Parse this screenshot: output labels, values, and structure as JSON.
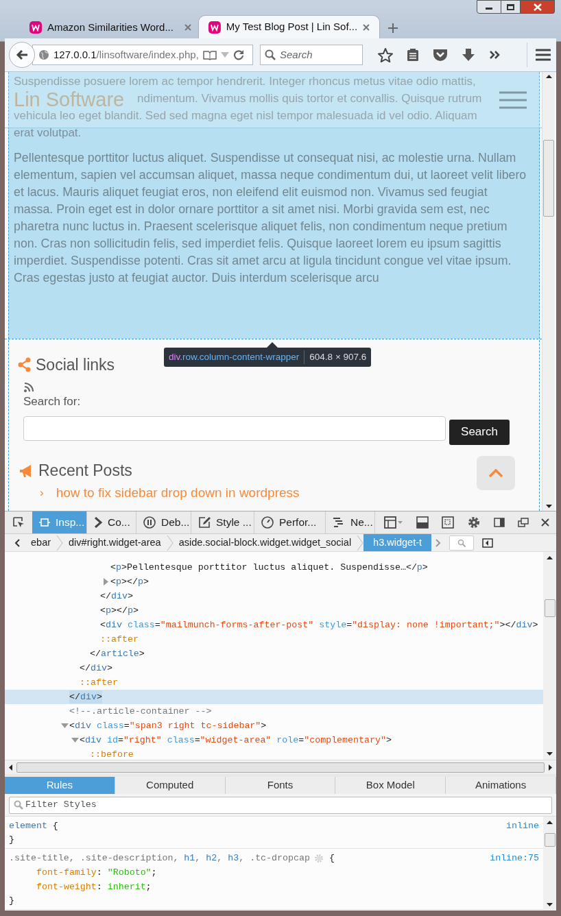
{
  "browser": {
    "tabs": [
      {
        "title": "Amazon Similarities Word...",
        "selected": false
      },
      {
        "title": "My Test Blog Post | Lin Sof...",
        "selected": true
      }
    ],
    "url": {
      "host": "127.0.0.1",
      "path": "/linsoftware/index.php,"
    },
    "search": {
      "placeholder": "Search"
    }
  },
  "page": {
    "site_title": "Lin Software",
    "intro_lines": [
      "Suspendisse posuere lorem ac tempor hendrerit. Integer rhoncus metus vitae odio mattis,",
      "ndimentum. Vivamus mollis quis tortor et convallis. Quisque rutrum",
      "vehicula leo eget blandit. Sed sed magna eget nisl tempor malesuada id vel odio. Aliquam",
      "erat volutpat."
    ],
    "paragraph": "Pellentesque porttitor luctus aliquet. Suspendisse ut consequat nisi, ac molestie urna. Nullam elementum, sapien vel accumsan aliquet, massa neque condimentum dui, ut laoreet velit libero et lacus. Mauris aliquet feugiat eros, non eleifend elit euismod non. Vivamus sed feugiat massa. Proin eget est in dolor ornare porttitor a sit amet nisi. Morbi gravida sem est, nec pharetra nunc luctus in. Praesent scelerisque aliquet felis, non condimentum neque pretium non. Cras non sollicitudin felis, sed imperdiet felis. Quisque laoreet lorem eu ipsum sagittis imperdiet. Suspendisse potenti. Cras sit amet arcu at ligula tincidunt congue vel vitae ipsum. Cras egestas justo at feugiat auctor. Duis interdum scelerisque arcu",
    "tooltip": {
      "tag": "div",
      "classes": ".row.column-content-wrapper",
      "size": "604.8 × 907.6"
    },
    "social_heading": "Social links",
    "search_label": "Search for:",
    "search_button": "Search",
    "recent_heading": "Recent Posts",
    "recent_posts": [
      {
        "marker": "›",
        "title": "how to fix sidebar drop down in wordpress"
      }
    ]
  },
  "devtools": {
    "tools": [
      {
        "label": "Insp...",
        "selected": true
      },
      {
        "label": "Co...",
        "selected": false
      },
      {
        "label": "Deb...",
        "selected": false
      },
      {
        "label": "Style ...",
        "selected": false
      },
      {
        "label": "Perfor...",
        "selected": false
      },
      {
        "label": "Ne...",
        "selected": false
      }
    ],
    "breadcrumbs": [
      {
        "label": "ebar",
        "selected": false
      },
      {
        "label": "div#right.widget-area",
        "selected": false
      },
      {
        "label": "aside.social-block.widget.widget_social",
        "selected": false
      },
      {
        "label": "h3.widget-t",
        "selected": true
      }
    ],
    "markup": [
      {
        "children": [
          {
            "children": [
              {
                "children": [
                  {
                    "children": [
                      {
                        "selected": false,
                        "tokens": [
                          {
                            "kind": "punct",
                            "text": "<"
                          },
                          {
                            "kind": "name",
                            "text": "p"
                          },
                          {
                            "kind": "punct",
                            "text": ">Pellentesque porttitor luctus aliquet. Suspendisse…</"
                          },
                          {
                            "kind": "name",
                            "text": "p"
                          },
                          {
                            "kind": "punct",
                            "text": ">"
                          }
                        ]
                      },
                      {
                        "selected": false,
                        "expanded": false,
                        "tokens": [
                          {
                            "kind": "punct",
                            "text": "<"
                          },
                          {
                            "kind": "name",
                            "text": "p"
                          },
                          {
                            "kind": "punct",
                            "text": "></"
                          },
                          {
                            "kind": "name",
                            "text": "p"
                          },
                          {
                            "kind": "punct",
                            "text": ">"
                          }
                        ]
                      }
                    ]
                  },
                  {
                    "selected": false,
                    "tokens": [
                      {
                        "kind": "punct",
                        "text": "</"
                      },
                      {
                        "kind": "name",
                        "text": "div"
                      },
                      {
                        "kind": "punct",
                        "text": ">"
                      }
                    ]
                  },
                  {
                    "selected": false,
                    "tokens": [
                      {
                        "kind": "punct",
                        "text": "<"
                      },
                      {
                        "kind": "name",
                        "text": "p"
                      },
                      {
                        "kind": "punct",
                        "text": "></"
                      },
                      {
                        "kind": "name",
                        "text": "p"
                      },
                      {
                        "kind": "punct",
                        "text": ">"
                      }
                    ]
                  },
                  {
                    "selected": false,
                    "tokens": [
                      {
                        "kind": "punct",
                        "text": "<"
                      },
                      {
                        "kind": "name",
                        "text": "div"
                      },
                      {
                        "kind": "attr",
                        "text": " class"
                      },
                      {
                        "kind": "punct",
                        "text": "="
                      },
                      {
                        "kind": "value",
                        "text": "\"mailmunch-forms-after-post\""
                      },
                      {
                        "kind": "attr",
                        "text": " style"
                      },
                      {
                        "kind": "punct",
                        "text": "="
                      },
                      {
                        "kind": "value",
                        "text": "\"display: none !important;\""
                      },
                      {
                        "kind": "punct",
                        "text": "></"
                      },
                      {
                        "kind": "name",
                        "text": "div"
                      },
                      {
                        "kind": "punct",
                        "text": ">"
                      }
                    ]
                  },
                  {
                    "selected": false,
                    "tokens": [
                      {
                        "kind": "pseudo",
                        "text": "::after"
                      }
                    ]
                  }
                ]
              },
              {
                "selected": false,
                "tokens": [
                  {
                    "kind": "punct",
                    "text": "</"
                  },
                  {
                    "kind": "name",
                    "text": "article"
                  },
                  {
                    "kind": "punct",
                    "text": ">"
                  }
                ]
              }
            ]
          },
          {
            "selected": false,
            "tokens": [
              {
                "kind": "punct",
                "text": "</"
              },
              {
                "kind": "name",
                "text": "div"
              },
              {
                "kind": "punct",
                "text": ">"
              }
            ]
          },
          {
            "selected": false,
            "tokens": [
              {
                "kind": "pseudo",
                "text": "::after"
              }
            ]
          }
        ]
      },
      {
        "selected": true,
        "tokens": [
          {
            "kind": "punct",
            "text": "</"
          },
          {
            "kind": "name",
            "text": "div"
          },
          {
            "kind": "punct",
            "text": ">"
          }
        ]
      },
      {
        "selected": false,
        "tokens": [
          {
            "kind": "comment",
            "text": "<!--.article-container -->"
          }
        ]
      },
      {
        "selected": false,
        "expanded": true,
        "tokens": [
          {
            "kind": "punct",
            "text": "<"
          },
          {
            "kind": "name",
            "text": "div"
          },
          {
            "kind": "attr",
            "text": " class"
          },
          {
            "kind": "punct",
            "text": "="
          },
          {
            "kind": "value",
            "text": "\"span3 right tc-sidebar\""
          },
          {
            "kind": "punct",
            "text": ">"
          }
        ],
        "children": [
          {
            "selected": false,
            "expanded": true,
            "tokens": [
              {
                "kind": "punct",
                "text": "<"
              },
              {
                "kind": "name",
                "text": "div"
              },
              {
                "kind": "attr",
                "text": " id"
              },
              {
                "kind": "punct",
                "text": "="
              },
              {
                "kind": "value",
                "text": "\"right\""
              },
              {
                "kind": "attr",
                "text": " class"
              },
              {
                "kind": "punct",
                "text": "="
              },
              {
                "kind": "value",
                "text": "\"widget-area\""
              },
              {
                "kind": "attr",
                "text": " role"
              },
              {
                "kind": "punct",
                "text": "="
              },
              {
                "kind": "value",
                "text": "\"complementary\""
              },
              {
                "kind": "punct",
                "text": ">"
              }
            ],
            "children": [
              {
                "selected": false,
                "tokens": [
                  {
                    "kind": "pseudo",
                    "text": "::before"
                  }
                ]
              }
            ]
          }
        ]
      }
    ],
    "side_tabs": [
      {
        "label": "Rules",
        "selected": true
      },
      {
        "label": "Computed",
        "selected": false
      },
      {
        "label": "Fonts",
        "selected": false
      },
      {
        "label": "Box Model",
        "selected": false
      },
      {
        "label": "Animations",
        "selected": false
      }
    ],
    "filter": {
      "placeholder": "Filter Styles"
    },
    "rules": [
      {
        "selector": [
          {
            "kind": "name",
            "text": "element"
          }
        ],
        "gear": false,
        "open": "{",
        "close": "}",
        "source": "inline"
      },
      {
        "selector": [
          {
            "kind": "comment",
            "text": ".site-title, .site-description, "
          },
          {
            "kind": "name",
            "text": "h1"
          },
          {
            "kind": "comment",
            "text": ", "
          },
          {
            "kind": "name",
            "text": "h2"
          },
          {
            "kind": "comment",
            "text": ", "
          },
          {
            "kind": "name",
            "text": "h3"
          },
          {
            "kind": "comment",
            "text": ", .tc-dropcap"
          }
        ],
        "gear": true,
        "open": "{",
        "close": "}",
        "source": "inline:75",
        "declarations": [
          [
            {
              "kind": "pseudo",
              "text": "font-family"
            },
            {
              "kind": "punct",
              "text": ": "
            },
            {
              "kind": "string",
              "text": "\"Roboto\""
            },
            {
              "kind": "punct",
              "text": ";"
            }
          ],
          [
            {
              "kind": "pseudo",
              "text": "font-weight"
            },
            {
              "kind": "punct",
              "text": ": "
            },
            {
              "kind": "string",
              "text": "inherit"
            },
            {
              "kind": "punct",
              "text": ";"
            }
          ]
        ]
      }
    ]
  }
}
